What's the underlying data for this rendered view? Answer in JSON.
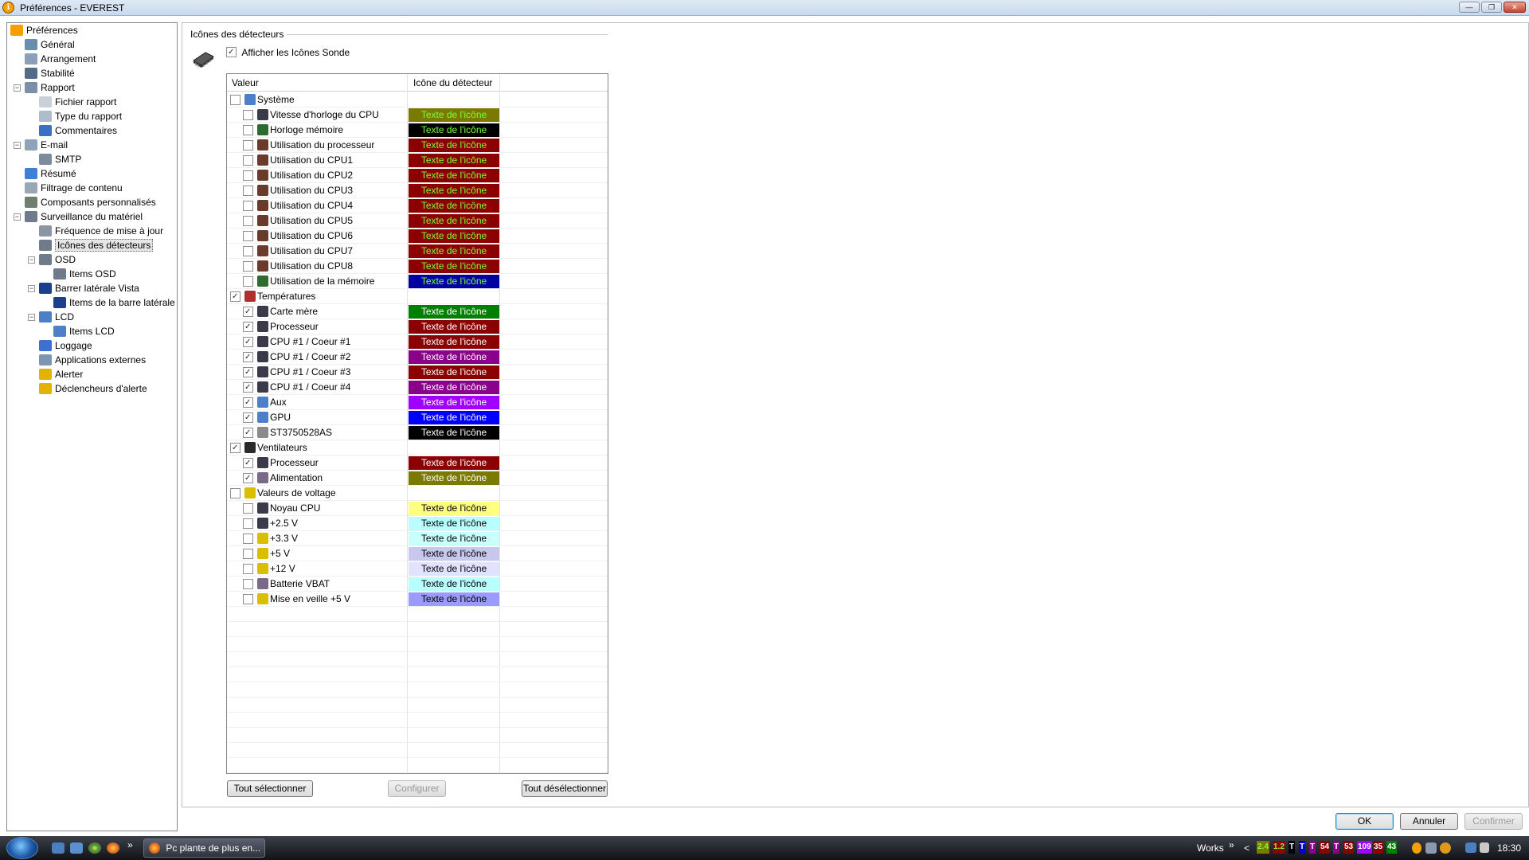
{
  "window": {
    "title": "Préférences - EVEREST",
    "controls": {
      "minimize": "—",
      "maximize": "❐",
      "close": "✕"
    }
  },
  "tree": [
    {
      "label": "Préférences",
      "icon": "info-icon",
      "level": 0,
      "color": "#f4a000"
    },
    {
      "label": "Général",
      "icon": "gear-icon",
      "level": 1,
      "color": "#6a8caf"
    },
    {
      "label": "Arrangement",
      "icon": "arrangement-icon",
      "level": 1,
      "color": "#8aa0b8"
    },
    {
      "label": "Stabilité",
      "icon": "stability-icon",
      "level": 1,
      "color": "#556b8a"
    },
    {
      "label": "Rapport",
      "icon": "report-icon",
      "level": 1,
      "color": "#7a90a8",
      "expanded": true
    },
    {
      "label": "Fichier rapport",
      "icon": "file-icon",
      "level": 2,
      "color": "#c8d0da"
    },
    {
      "label": "Type du rapport",
      "icon": "report-type-icon",
      "level": 2,
      "color": "#b0bccb"
    },
    {
      "label": "Commentaires",
      "icon": "comment-icon",
      "level": 2,
      "color": "#3b6fc4"
    },
    {
      "label": "E-mail",
      "icon": "email-icon",
      "level": 1,
      "color": "#8fa3bb",
      "expanded": true
    },
    {
      "label": "SMTP",
      "icon": "smtp-icon",
      "level": 2,
      "color": "#7c8c9e"
    },
    {
      "label": "Résumé",
      "icon": "summary-icon",
      "level": 1,
      "color": "#3f7fd6"
    },
    {
      "label": "Filtrage de contenu",
      "icon": "filter-icon",
      "level": 1,
      "color": "#9aa7b5"
    },
    {
      "label": "Composants personnalisés",
      "icon": "components-icon",
      "level": 1,
      "color": "#6f7f6f"
    },
    {
      "label": "Surveillance du matériel",
      "icon": "hardware-icon",
      "level": 1,
      "color": "#6f7b8a",
      "expanded": true
    },
    {
      "label": "Fréquence de mise à jour",
      "icon": "refresh-icon",
      "level": 2,
      "color": "#8a96a4"
    },
    {
      "label": "Icônes des détecteurs",
      "icon": "sensor-icon",
      "level": 2,
      "color": "#6f7b8a",
      "selected": true
    },
    {
      "label": "OSD",
      "icon": "osd-icon",
      "level": 2,
      "color": "#6f7b8a",
      "expanded": true
    },
    {
      "label": "Items OSD",
      "icon": "osd-items-icon",
      "level": 3,
      "color": "#6f7b8a"
    },
    {
      "label": "Barrer latérale Vista",
      "icon": "sidebar-icon",
      "level": 2,
      "color": "#1b3f8c",
      "expanded": true
    },
    {
      "label": "Items de la barre latérale",
      "icon": "sidebar-items-icon",
      "level": 3,
      "color": "#1b3f8c"
    },
    {
      "label": "LCD",
      "icon": "lcd-icon",
      "level": 2,
      "color": "#4d7fc9",
      "expanded": true
    },
    {
      "label": "Items LCD",
      "icon": "lcd-items-icon",
      "level": 3,
      "color": "#4d7fc9"
    },
    {
      "label": "Loggage",
      "icon": "log-icon",
      "level": 2,
      "color": "#3f6fd0"
    },
    {
      "label": "Applications externes",
      "icon": "external-apps-icon",
      "level": 2,
      "color": "#7c95b3"
    },
    {
      "label": "Alerter",
      "icon": "warning-icon",
      "level": 2,
      "color": "#e0b400"
    },
    {
      "label": "Déclencheurs d'alerte",
      "icon": "alert-trigger-icon",
      "level": 2,
      "color": "#e0b400"
    }
  ],
  "panel": {
    "group_title": "Icônes des détecteurs",
    "show_probes_label": "Afficher les Icônes Sonde",
    "show_probes_checked": true,
    "columns": [
      "Valeur",
      "Icône du détecteur"
    ],
    "rows": [
      {
        "type": "group",
        "label": "Système",
        "checked": false,
        "icon": "computer-icon",
        "icon_color": "#4d7fc9"
      },
      {
        "type": "item",
        "label": "Vitesse d'horloge du CPU",
        "checked": false,
        "icon": "cpu-icon",
        "icon_color": "#3a3a4a",
        "swatch_text": "Texte de l'icône",
        "bg": "#7a7a00",
        "fg": "#7cff3a"
      },
      {
        "type": "item",
        "label": "Horloge mémoire",
        "checked": false,
        "icon": "memory-icon",
        "icon_color": "#2e6b2e",
        "swatch_text": "Texte de l'icône",
        "bg": "#000000",
        "fg": "#7cff3a"
      },
      {
        "type": "item",
        "label": "Utilisation du processeur",
        "checked": false,
        "icon": "hourglass-icon",
        "icon_color": "#6a3a2a",
        "swatch_text": "Texte de l'icône",
        "bg": "#8b0000",
        "fg": "#7cff3a"
      },
      {
        "type": "item",
        "label": "Utilisation du CPU1",
        "checked": false,
        "icon": "hourglass-icon",
        "icon_color": "#6a3a2a",
        "swatch_text": "Texte de l'icône",
        "bg": "#8b0000",
        "fg": "#7cff3a"
      },
      {
        "type": "item",
        "label": "Utilisation du CPU2",
        "checked": false,
        "icon": "hourglass-icon",
        "icon_color": "#6a3a2a",
        "swatch_text": "Texte de l'icône",
        "bg": "#8b0000",
        "fg": "#7cff3a"
      },
      {
        "type": "item",
        "label": "Utilisation du CPU3",
        "checked": false,
        "icon": "hourglass-icon",
        "icon_color": "#6a3a2a",
        "swatch_text": "Texte de l'icône",
        "bg": "#8b0000",
        "fg": "#7cff3a"
      },
      {
        "type": "item",
        "label": "Utilisation du CPU4",
        "checked": false,
        "icon": "hourglass-icon",
        "icon_color": "#6a3a2a",
        "swatch_text": "Texte de l'icône",
        "bg": "#8b0000",
        "fg": "#7cff3a"
      },
      {
        "type": "item",
        "label": "Utilisation du CPU5",
        "checked": false,
        "icon": "hourglass-icon",
        "icon_color": "#6a3a2a",
        "swatch_text": "Texte de l'icône",
        "bg": "#8b0000",
        "fg": "#7cff3a"
      },
      {
        "type": "item",
        "label": "Utilisation du CPU6",
        "checked": false,
        "icon": "hourglass-icon",
        "icon_color": "#6a3a2a",
        "swatch_text": "Texte de l'icône",
        "bg": "#8b0000",
        "fg": "#7cff3a"
      },
      {
        "type": "item",
        "label": "Utilisation du CPU7",
        "checked": false,
        "icon": "hourglass-icon",
        "icon_color": "#6a3a2a",
        "swatch_text": "Texte de l'icône",
        "bg": "#8b0000",
        "fg": "#7cff3a"
      },
      {
        "type": "item",
        "label": "Utilisation du CPU8",
        "checked": false,
        "icon": "hourglass-icon",
        "icon_color": "#6a3a2a",
        "swatch_text": "Texte de l'icône",
        "bg": "#8b0000",
        "fg": "#7cff3a"
      },
      {
        "type": "item",
        "label": "Utilisation de la mémoire",
        "checked": false,
        "icon": "memory-icon",
        "icon_color": "#2e6b2e",
        "swatch_text": "Texte de l'icône",
        "bg": "#0000a0",
        "fg": "#7cff3a"
      },
      {
        "type": "group",
        "label": "Températures",
        "checked": true,
        "icon": "thermometer-icon",
        "icon_color": "#b03030"
      },
      {
        "type": "item",
        "label": "Carte mère",
        "checked": true,
        "icon": "motherboard-icon",
        "icon_color": "#3a3a4a",
        "swatch_text": "Texte de l'icône",
        "bg": "#008000",
        "fg": "#ffffff"
      },
      {
        "type": "item",
        "label": "Processeur",
        "checked": true,
        "icon": "cpu-icon",
        "icon_color": "#3a3a4a",
        "swatch_text": "Texte de l'icône",
        "bg": "#8b0000",
        "fg": "#ffffff"
      },
      {
        "type": "item",
        "label": "CPU #1 / Coeur #1",
        "checked": true,
        "icon": "cpu-icon",
        "icon_color": "#3a3a4a",
        "swatch_text": "Texte de l'icône",
        "bg": "#8b0000",
        "fg": "#ffffff"
      },
      {
        "type": "item",
        "label": "CPU #1 / Coeur #2",
        "checked": true,
        "icon": "cpu-icon",
        "icon_color": "#3a3a4a",
        "swatch_text": "Texte de l'icône",
        "bg": "#8b008b",
        "fg": "#ffffff"
      },
      {
        "type": "item",
        "label": "CPU #1 / Coeur #3",
        "checked": true,
        "icon": "cpu-icon",
        "icon_color": "#3a3a4a",
        "swatch_text": "Texte de l'icône",
        "bg": "#8b0000",
        "fg": "#ffffff"
      },
      {
        "type": "item",
        "label": "CPU #1 / Coeur #4",
        "checked": true,
        "icon": "cpu-icon",
        "icon_color": "#3a3a4a",
        "swatch_text": "Texte de l'icône",
        "bg": "#8b008b",
        "fg": "#ffffff"
      },
      {
        "type": "item",
        "label": "Aux",
        "checked": true,
        "icon": "aux-icon",
        "icon_color": "#4d7fc9",
        "swatch_text": "Texte de l'icône",
        "bg": "#a000ff",
        "fg": "#ffffff"
      },
      {
        "type": "item",
        "label": "GPU",
        "checked": true,
        "icon": "gpu-icon",
        "icon_color": "#4d7fc9",
        "swatch_text": "Texte de l'icône",
        "bg": "#0000ff",
        "fg": "#ffffff"
      },
      {
        "type": "item",
        "label": "ST3750528AS",
        "checked": true,
        "icon": "hdd-icon",
        "icon_color": "#8a8a8a",
        "swatch_text": "Texte de l'icône",
        "bg": "#000000",
        "fg": "#ffffff"
      },
      {
        "type": "group",
        "label": "Ventilateurs",
        "checked": true,
        "icon": "fan-icon",
        "icon_color": "#2a2a2a"
      },
      {
        "type": "item",
        "label": "Processeur",
        "checked": true,
        "icon": "cpu-icon",
        "icon_color": "#3a3a4a",
        "swatch_text": "Texte de l'icône",
        "bg": "#8b0000",
        "fg": "#ffffff"
      },
      {
        "type": "item",
        "label": "Alimentation",
        "checked": true,
        "icon": "power-supply-icon",
        "icon_color": "#7a6a8a",
        "swatch_text": "Texte de l'icône",
        "bg": "#7a7a00",
        "fg": "#ffffff"
      },
      {
        "type": "group",
        "label": "Valeurs de voltage",
        "checked": false,
        "icon": "voltage-icon",
        "icon_color": "#d8c000"
      },
      {
        "type": "item",
        "label": "Noyau CPU",
        "checked": false,
        "icon": "cpu-icon",
        "icon_color": "#3a3a4a",
        "swatch_text": "Texte de l'icône",
        "bg": "#ffff80",
        "fg": "#000000"
      },
      {
        "type": "item",
        "label": "+2.5 V",
        "checked": false,
        "icon": "cpu-icon",
        "icon_color": "#3a3a4a",
        "swatch_text": "Texte de l'icône",
        "bg": "#b8ffff",
        "fg": "#000000"
      },
      {
        "type": "item",
        "label": "+3.3 V",
        "checked": false,
        "icon": "voltage-icon",
        "icon_color": "#d8c000",
        "swatch_text": "Texte de l'icône",
        "bg": "#c8ffff",
        "fg": "#000000"
      },
      {
        "type": "item",
        "label": "+5 V",
        "checked": false,
        "icon": "voltage-icon",
        "icon_color": "#d8c000",
        "swatch_text": "Texte de l'icône",
        "bg": "#c8c8ee",
        "fg": "#000000"
      },
      {
        "type": "item",
        "label": "+12 V",
        "checked": false,
        "icon": "voltage-icon",
        "icon_color": "#d8c000",
        "swatch_text": "Texte de l'icône",
        "bg": "#e2e2ff",
        "fg": "#000000"
      },
      {
        "type": "item",
        "label": "Batterie VBAT",
        "checked": false,
        "icon": "battery-icon",
        "icon_color": "#7a6a8a",
        "swatch_text": "Texte de l'icône",
        "bg": "#b8ffff",
        "fg": "#000000"
      },
      {
        "type": "item",
        "label": "Mise en veille +5 V",
        "checked": false,
        "icon": "voltage-icon",
        "icon_color": "#d8c000",
        "swatch_text": "Texte de l'icône",
        "bg": "#9a9aff",
        "fg": "#000000"
      }
    ],
    "buttons": {
      "select_all": "Tout sélectionner",
      "configure": "Configurer",
      "deselect_all": "Tout désélectionner"
    }
  },
  "dialog_buttons": {
    "ok": "OK",
    "cancel": "Annuler",
    "confirm": "Confirmer"
  },
  "taskbar": {
    "task_label": "Pc plante de plus en...",
    "works_label": "Works",
    "chevron": "»",
    "arrow": "<",
    "tray_values": [
      {
        "text": "2.4",
        "bg": "#7a7a00",
        "fg": "#7cff3a"
      },
      {
        "text": "1.2",
        "bg": "#8b0000",
        "fg": "#7cff3a"
      },
      {
        "text": "T",
        "bg": "#000000",
        "fg": "#ffffff"
      },
      {
        "text": "T",
        "bg": "#0000c0",
        "fg": "#ffffff"
      },
      {
        "text": "T",
        "bg": "#8b008b",
        "fg": "#ffffff"
      },
      {
        "text": "54",
        "bg": "#8b0000",
        "fg": "#ffffff"
      },
      {
        "text": "T",
        "bg": "#8b008b",
        "fg": "#ffffff"
      },
      {
        "text": "53",
        "bg": "#8b0000",
        "fg": "#ffffff"
      },
      {
        "text": "109",
        "bg": "#a000ff",
        "fg": "#ffffff"
      },
      {
        "text": "35",
        "bg": "#8b0000",
        "fg": "#ffffff"
      },
      {
        "text": "43",
        "bg": "#008000",
        "fg": "#ffffff"
      }
    ],
    "clock": "18:30"
  }
}
